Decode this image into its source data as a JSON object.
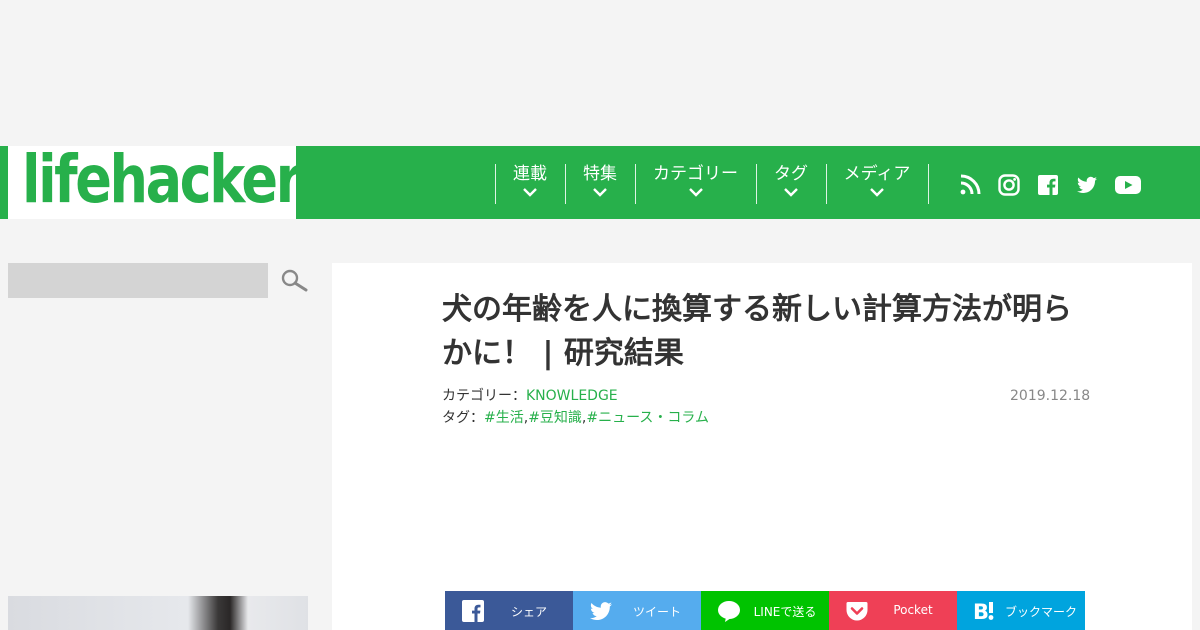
{
  "brand": {
    "logo": "lifehacker",
    "color": "#27b04b"
  },
  "nav": {
    "items": [
      {
        "label": "連載"
      },
      {
        "label": "特集"
      },
      {
        "label": "カテゴリー"
      },
      {
        "label": "タグ"
      },
      {
        "label": "メディア"
      }
    ],
    "social": [
      "rss-icon",
      "instagram-icon",
      "facebook-icon",
      "twitter-icon",
      "youtube-icon"
    ]
  },
  "search": {
    "placeholder": ""
  },
  "article": {
    "title": "犬の年齢を人に換算する新しい計算方法が明らかに！ | 研究結果",
    "category_label": "カテゴリー：",
    "category": "KNOWLEDGE",
    "tags_label": "タグ：",
    "tags": [
      "#生活",
      "#豆知識",
      "#ニュース・コラム"
    ],
    "date": "2019.12.18"
  },
  "share": [
    {
      "label": "シェア",
      "icon": "facebook-icon",
      "color": "#3b5998"
    },
    {
      "label": "ツイート",
      "icon": "twitter-icon",
      "color": "#55acee"
    },
    {
      "label": "LINEで送る",
      "icon": "line-icon",
      "color": "#00c300"
    },
    {
      "label": "Pocket",
      "icon": "pocket-icon",
      "color": "#ef4056"
    },
    {
      "label": "ブックマーク",
      "icon": "hatena-icon",
      "color": "#00a4de"
    }
  ]
}
